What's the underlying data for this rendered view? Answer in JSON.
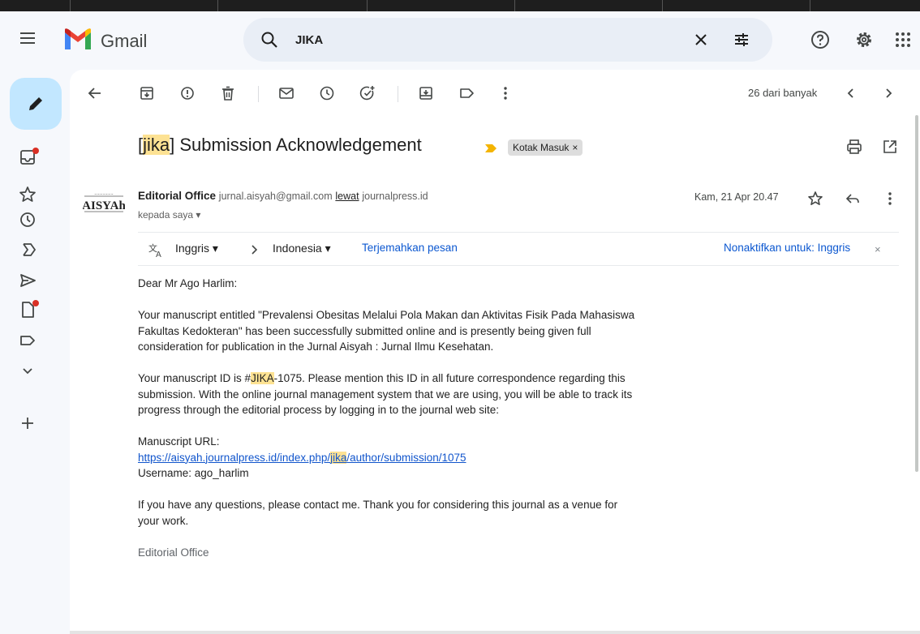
{
  "app": {
    "name": "Gmail",
    "brand_colors": {
      "red": "#ea4335",
      "blue": "#4285f4",
      "green": "#34a853",
      "yellow": "#fbbc04"
    }
  },
  "search": {
    "query": "JIKA",
    "icons": {
      "search": "search-icon",
      "clear": "close-icon",
      "options": "tune-icon"
    }
  },
  "header_icons": [
    "help-icon",
    "settings-icon",
    "apps-grid-icon"
  ],
  "rail": {
    "compose_icon": "pencil-icon",
    "items": [
      {
        "icon": "inbox-icon",
        "badge": true
      },
      {
        "icon": "star-icon",
        "badge": false
      },
      {
        "icon": "clock-icon",
        "badge": false
      },
      {
        "icon": "important-icon",
        "badge": false
      },
      {
        "icon": "send-icon",
        "badge": false
      },
      {
        "icon": "draft-icon",
        "badge": true
      },
      {
        "icon": "label-icon",
        "badge": false
      },
      {
        "icon": "chevron-down-icon",
        "badge": false
      },
      {
        "icon": "plus-icon",
        "badge": false
      }
    ],
    "badge_color": "#d93025"
  },
  "toolbar": {
    "icons": [
      "back-arrow-icon",
      "archive-icon",
      "report-spam-icon",
      "delete-icon",
      "mark-unread-icon",
      "snooze-icon",
      "add-task-icon",
      "move-to-icon",
      "label-as-icon",
      "more-vert-icon"
    ],
    "counter": "26 dari banyak",
    "prev_icon": "chevron-left-icon",
    "next_icon": "chevron-right-icon"
  },
  "email": {
    "subject_prefix": "[",
    "subject_highlight": "jika",
    "subject_rest": "] Submission Acknowledgement",
    "label": "Kotak Masuk",
    "label_remove": "×",
    "print_icon": "print-icon",
    "popout_icon": "open-in-new-icon",
    "avatar_text": "AISYAh",
    "sender_name": "Editorial Office",
    "sender_email": "jurnal.aisyah@gmail.com",
    "via_word": "lewat",
    "via_domain": "journalpress.id",
    "to": "kepada saya",
    "date": "Kam, 21 Apr 20.47",
    "actions": [
      "star-icon",
      "reply-icon",
      "more-vert-icon"
    ]
  },
  "translate": {
    "from": "Inggris",
    "to": "Indonesia",
    "action": "Terjemahkan pesan",
    "disable": "Nonaktifkan untuk: Inggris",
    "close": "×"
  },
  "body": {
    "greeting": "Dear Mr Ago Harlim:",
    "p1": "Your manuscript entitled \"Prevalensi Obesitas Melalui Pola Makan dan Aktivitas Fisik Pada Mahasiswa Fakultas Kedokteran\" has been successfully submitted online and is presently being given full consideration for publication in the Jurnal Aisyah : Jurnal Ilmu Kesehatan.",
    "p2_before": "Your manuscript ID is #",
    "p2_highlight": "JIKA",
    "p2_after": "-1075. Please mention this ID in all future correspondence regarding this submission. With the online journal management system that we are using, you will be able to track its progress through the editorial process by logging in to the journal web site:",
    "url_label": "Manuscript URL:",
    "url_before": "https://aisyah.journalpress.id/index.php/",
    "url_highlight": "jika",
    "url_after": "/author/submission/1075",
    "username": "Username: ago_harlim",
    "p3": "If you have any questions, please contact me. Thank you for considering this journal as a venue for your work.",
    "signature": "Editorial Office"
  }
}
